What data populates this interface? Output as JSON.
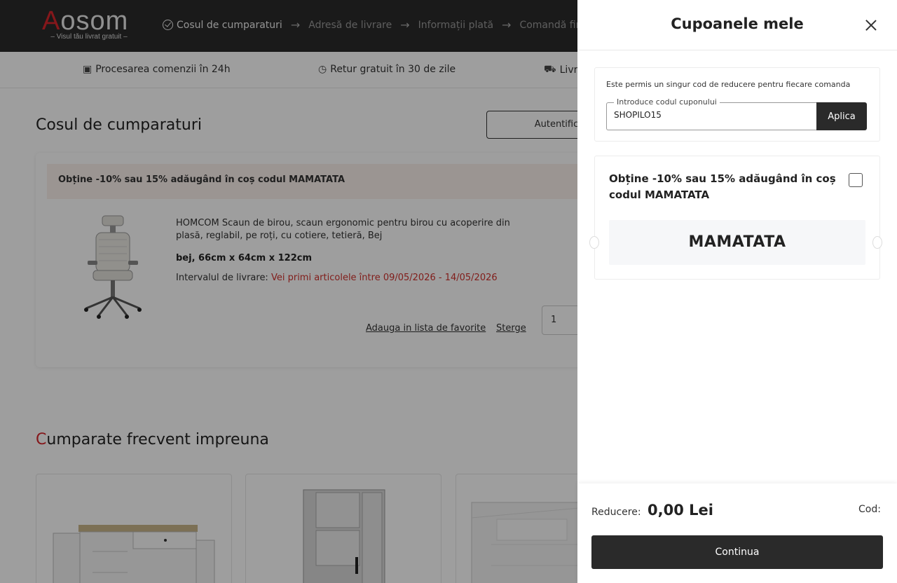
{
  "header": {
    "logo_text": "osom",
    "logo_initial": "A",
    "logo_tagline": "– Visul tău livrat gratuit –",
    "steps": [
      {
        "label": "Cosul de cumparaturi"
      },
      {
        "label": "Adresă de livrare"
      },
      {
        "label": "Informații plată"
      },
      {
        "label": "Comandă fin"
      }
    ]
  },
  "benefits": [
    {
      "label": "Procesarea comenzii în 24h",
      "icon": "calendar-icon"
    },
    {
      "label": "Retur gratuit în 30 de zile",
      "icon": "return-clock-icon"
    },
    {
      "label": "Livr",
      "icon": "truck-icon"
    }
  ],
  "cart": {
    "title": "Cosul de cumparaturi",
    "login_button": "Autentific",
    "promo": "Obține -10% sau 15% adăugând în coș codul MAMATATA",
    "item": {
      "title": "HOMCOM Scaun de birou, scaun ergonomic pentru birou cu acoperire din plasă, reglabil, pe roți, cu cotiere, tetieră, Bej",
      "variant": "bej, 66cm x 64cm x 122cm",
      "delivery_label": "Intervalul de livrare:",
      "delivery_value": "Vei primi articolele între 09/05/2026 - 14/05/2026",
      "favorite_link": "Adauga in lista de favorite",
      "delete_link": "Sterge",
      "quantity": "1"
    }
  },
  "recommended": {
    "title_first": "C",
    "title_rest": "umparate frecvent impreuna"
  },
  "drawer": {
    "title": "Cupoanele mele",
    "rule_text": "Este permis un singur cod de reducere pentru fiecare comanda",
    "input_legend": "Introduce codul cuponului",
    "input_value": "SHOPILO15",
    "apply_button": "Aplica",
    "offer": {
      "title": "Obține -10% sau 15% adăugând în coș codul MAMATATA",
      "code": "MAMATATA",
      "checked": false
    },
    "footer": {
      "discount_label": "Reducere:",
      "discount_value": "0,00 Lei",
      "code_label": "Cod:",
      "continue_button": "Continua"
    }
  },
  "colors": {
    "brand_red": "#d7262c",
    "dark": "#2a2a2a",
    "delivery_red": "#d0312d",
    "promo_bg": "#fbf1ec"
  }
}
